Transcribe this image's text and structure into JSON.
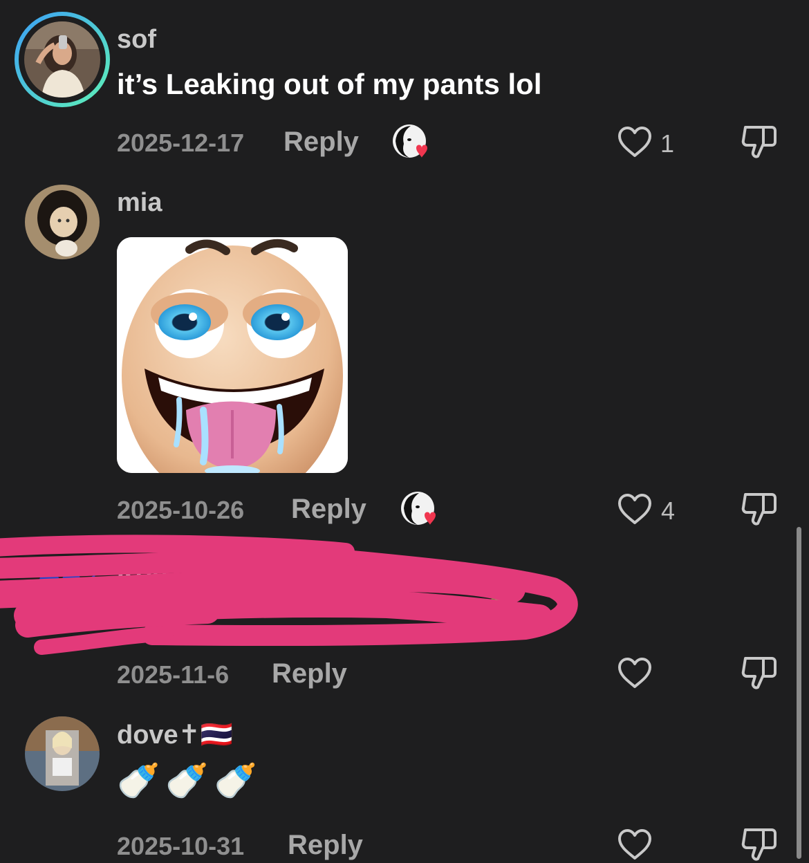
{
  "comments": [
    {
      "username": "sof",
      "text": "it’s Leaking out of my pants lol",
      "date": "2025-12-17",
      "reply_label": "Reply",
      "like_count": "1",
      "avatar_icon": "profile-photo-girl-mirror-selfie",
      "creator_liked": true
    },
    {
      "username": "mia",
      "sticker_icon": "drooling-grin-face-sticker",
      "date": "2025-10-26",
      "reply_label": "Reply",
      "like_count": "4",
      "avatar_icon": "profile-photo-anime-girl",
      "creator_liked": true
    },
    {
      "username": "Kon",
      "text": "",
      "date": "2025-11-6",
      "reply_label": "Reply",
      "like_count": "",
      "avatar_icon": "profile-photo-sonic",
      "redacted": true
    },
    {
      "username": "dove✝🇹🇭",
      "text": "🍼🍼🍼",
      "date": "2025-10-31",
      "reply_label": "Reply",
      "like_count": "",
      "avatar_icon": "profile-photo-blonde-person"
    }
  ],
  "icons": {
    "like": "heart-outline-icon",
    "dislike": "thumbs-down-outline-icon",
    "creator_like": "creator-avatar-with-heart-icon"
  },
  "colors": {
    "background": "#1e1e1f",
    "heart": "#f0364f",
    "scribble": "#e33a7a",
    "story_ring_start": "#3da1f5",
    "story_ring_end": "#5ef0b8"
  }
}
